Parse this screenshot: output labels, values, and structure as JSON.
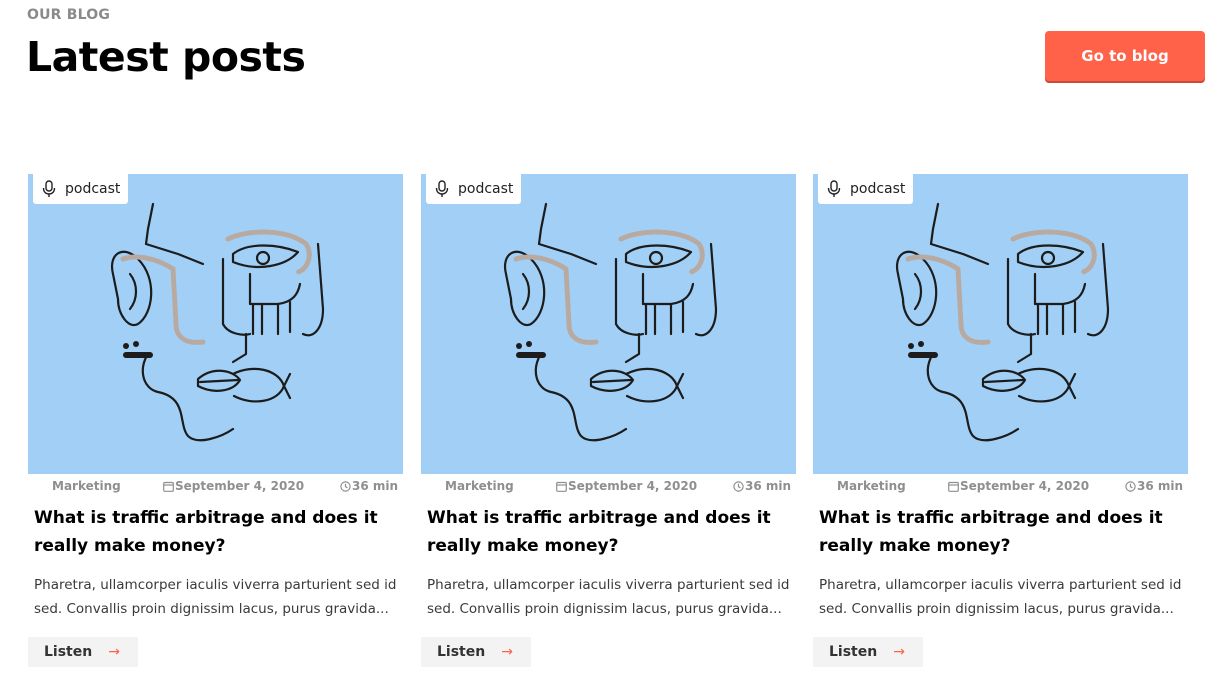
{
  "header": {
    "eyebrow": "OUR BLOG",
    "title": "Latest posts",
    "cta_label": "Go to blog"
  },
  "colors": {
    "accent": "#ff6248",
    "thumbnail_bg": "#a1cff5",
    "meta_text": "#8f8f8f"
  },
  "posts": [
    {
      "tag": "podcast",
      "tag_icon": "microphone-icon",
      "category": "Marketing",
      "date": "September 4, 2020",
      "duration": "36 min",
      "title": "What is traffic arbitrage and does it really make money?",
      "excerpt_line1": "Pharetra, ullamcorper iaculis viverra parturient sed id",
      "excerpt_line2": "sed. Convallis proin dignissim lacus, purus gravida...",
      "action_label": "Listen",
      "action_icon": "arrow-right-icon"
    },
    {
      "tag": "podcast",
      "tag_icon": "microphone-icon",
      "category": "Marketing",
      "date": "September 4, 2020",
      "duration": "36 min",
      "title": "What is traffic arbitrage and does it really make money?",
      "excerpt_line1": "Pharetra, ullamcorper iaculis viverra parturient sed id",
      "excerpt_line2": "sed. Convallis proin dignissim lacus, purus gravida...",
      "action_label": "Listen",
      "action_icon": "arrow-right-icon"
    },
    {
      "tag": "podcast",
      "tag_icon": "microphone-icon",
      "category": "Marketing",
      "date": "September 4, 2020",
      "duration": "36 min",
      "title": "What is traffic arbitrage and does it really make money?",
      "excerpt_line1": "Pharetra, ullamcorper iaculis viverra parturient sed id",
      "excerpt_line2": "sed. Convallis proin dignissim lacus, purus gravida...",
      "action_label": "Listen",
      "action_icon": "arrow-right-icon"
    }
  ]
}
